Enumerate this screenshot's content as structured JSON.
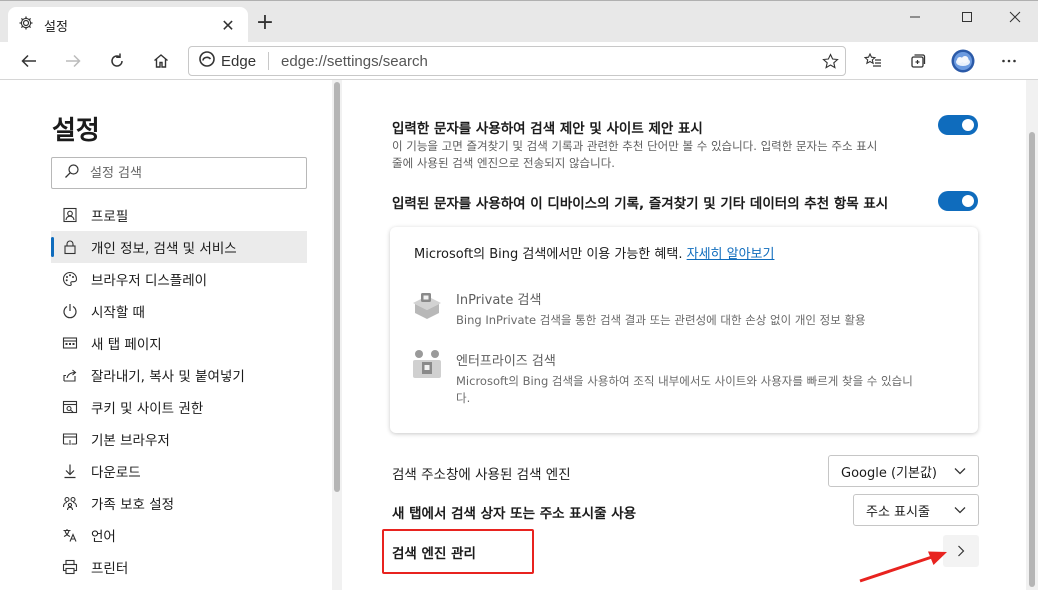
{
  "tab": {
    "title": "설정",
    "close": "✕",
    "new": "+"
  },
  "window": {
    "minimize": "—",
    "maximize": "☐",
    "close": "✕"
  },
  "address": {
    "site": "Edge",
    "url_host": "edge://",
    "url_rest": "settings/search"
  },
  "sidebar": {
    "title": "설정",
    "search_placeholder": "설정 검색",
    "items": [
      {
        "label": "프로필",
        "icon": "profile-icon",
        "active": false
      },
      {
        "label": "개인 정보, 검색 및 서비스",
        "icon": "lock-icon",
        "active": true
      },
      {
        "label": "브라우저 디스플레이",
        "icon": "palette-icon",
        "active": false
      },
      {
        "label": "시작할 때",
        "icon": "power-icon",
        "active": false
      },
      {
        "label": "새 탭 페이지",
        "icon": "newtab-page-icon",
        "active": false
      },
      {
        "label": "잘라내기, 복사 및 붙여넣기",
        "icon": "share-icon",
        "active": false
      },
      {
        "label": "쿠키 및 사이트 권한",
        "icon": "site-permissions-icon",
        "active": false
      },
      {
        "label": "기본 브라우저",
        "icon": "default-browser-icon",
        "active": false
      },
      {
        "label": "다운로드",
        "icon": "download-icon",
        "active": false
      },
      {
        "label": "가족 보호 설정",
        "icon": "family-icon",
        "active": false
      },
      {
        "label": "언어",
        "icon": "language-icon",
        "active": false
      },
      {
        "label": "프린터",
        "icon": "printer-icon",
        "active": false
      }
    ]
  },
  "main": {
    "suggest": {
      "title": "입력한 문자를 사용하여 검색 제안 및 사이트 제안 표시",
      "desc1": "이 기능을 고면 즐겨찾기 및 검색 기록과 관련한 추천 단어만 볼 수 있습니다. 입력한 문자는 주소 표시",
      "desc2": "줄에 사용된 검색 엔진으로 전송되지 않습니다.",
      "enabled": true
    },
    "history": {
      "title": "입력된 문자를 사용하여 이 디바이스의 기록, 즐겨찾기 및 기타 데이터의 추천 항목 표시",
      "enabled": true
    },
    "bing": {
      "headline": "Microsoft의 Bing 검색에서만 이용 가능한 혜택.",
      "link": "자세히 알아보기",
      "features": [
        {
          "title": "InPrivate 검색",
          "desc1": "Bing InPrivate 검색을 통한 검색 결과 또는 관련성에 대한 손상 없이 개인 정보 활용",
          "desc2": ""
        },
        {
          "title": "엔터프라이즈 검색",
          "desc1": "Microsoft의 Bing 검색을 사용하여 조직 내부에서도 사이트와 사용자를 빠르게 찾을 수 있습니",
          "desc2": "다."
        }
      ]
    },
    "engine": {
      "label": "검색 주소창에 사용된 검색 엔진",
      "value": "Google (기본값)"
    },
    "newtab": {
      "label": "새 탭에서 검색 상자 또는 주소 표시줄 사용",
      "value": "주소 표시줄"
    },
    "manage": {
      "label": "검색 엔진 관리"
    }
  },
  "colors": {
    "accent": "#0f6cbd",
    "annotation": "#e8231f"
  }
}
